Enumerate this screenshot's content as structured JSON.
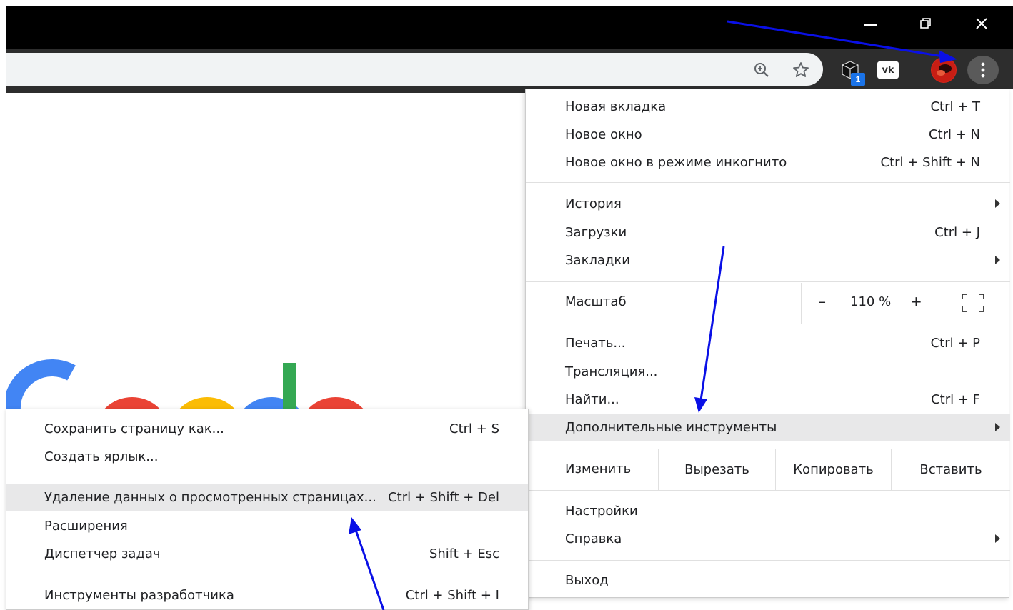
{
  "window": {
    "minimize_icon": "minimize-icon",
    "restore_icon": "restore-icon",
    "close_icon": "close-icon"
  },
  "toolbar": {
    "extension_badge": "1",
    "vk_label": "vk",
    "icons": [
      "zoom-icon",
      "star-icon",
      "extension-box-icon",
      "vk-icon",
      "avatar",
      "more-vert-icon"
    ]
  },
  "main_menu": {
    "new_tab": {
      "label": "Новая вкладка",
      "shortcut": "Ctrl + T"
    },
    "new_window": {
      "label": "Новое окно",
      "shortcut": "Ctrl + N"
    },
    "incognito": {
      "label": "Новое окно в режиме инкогнито",
      "shortcut": "Ctrl + Shift + N"
    },
    "history": {
      "label": "История"
    },
    "downloads": {
      "label": "Загрузки",
      "shortcut": "Ctrl + J"
    },
    "bookmarks": {
      "label": "Закладки"
    },
    "zoom": {
      "label": "Масштаб",
      "minus": "–",
      "value": "110 %",
      "plus": "+"
    },
    "print": {
      "label": "Печать...",
      "shortcut": "Ctrl + P"
    },
    "cast": {
      "label": "Трансляция..."
    },
    "find": {
      "label": "Найти...",
      "shortcut": "Ctrl + F"
    },
    "more_tools": {
      "label": "Дополнительные инструменты"
    },
    "edit": {
      "label": "Изменить",
      "cut": "Вырезать",
      "copy": "Копировать",
      "paste": "Вставить"
    },
    "settings": {
      "label": "Настройки"
    },
    "help": {
      "label": "Справка"
    },
    "exit": {
      "label": "Выход"
    }
  },
  "sub_menu": {
    "save_page": {
      "label": "Сохранить страницу как...",
      "shortcut": "Ctrl + S"
    },
    "create_shortcut": {
      "label": "Создать ярлык..."
    },
    "clear_data": {
      "label": "Удаление данных о просмотренных страницах...",
      "shortcut": "Ctrl + Shift + Del"
    },
    "extensions": {
      "label": "Расширения"
    },
    "task_manager": {
      "label": "Диспетчер задач",
      "shortcut": "Shift + Esc"
    },
    "dev_tools": {
      "label": "Инструменты разработчика",
      "shortcut": "Ctrl + Shift + I"
    }
  },
  "colors": {
    "annotation_arrow": "#0a10e6",
    "highlight": "#e8e8e9",
    "titlebar": "#000000",
    "toolbar": "#2d2d2d"
  }
}
